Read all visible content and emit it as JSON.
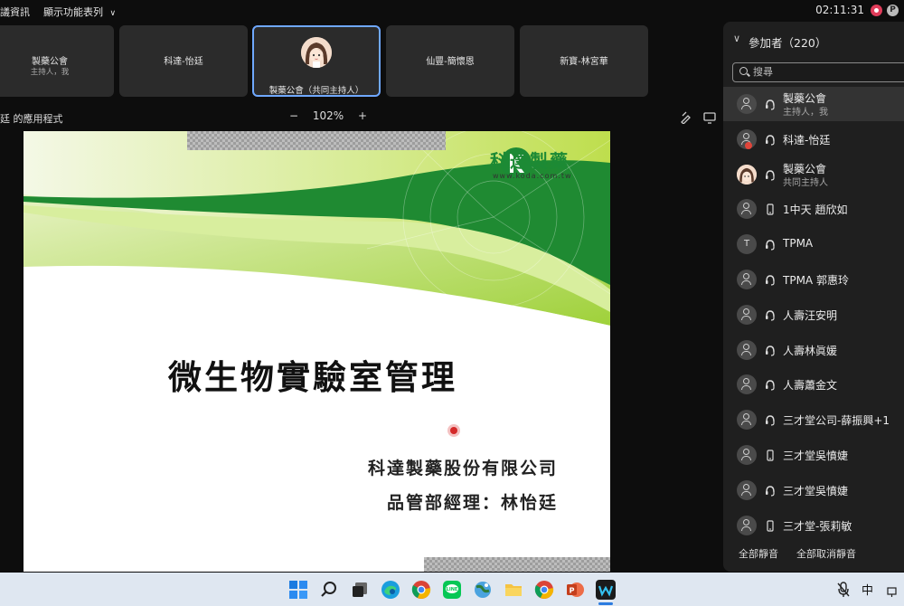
{
  "topbar": {
    "menu_info": "議資訊",
    "menu_toolbar": "顯示功能表列",
    "clock": "02:11:31"
  },
  "tiles": [
    {
      "name": "製藥公會",
      "sub": "主持人，我"
    },
    {
      "name": "科達-怡廷",
      "sub": ""
    },
    {
      "name": "製藥公會（共同主持人）",
      "sub": ""
    },
    {
      "name": "仙豐-簡懷恩",
      "sub": ""
    },
    {
      "name": "新寶-林宮華",
      "sub": ""
    }
  ],
  "share": {
    "app_label": "廷 的應用程式",
    "zoom": "102%"
  },
  "slide": {
    "logo_text": "科達製藥",
    "logo_url": "www.koda.com.tw",
    "title": "微生物實驗室管理",
    "company": "科達製藥股份有限公司",
    "manager": "品管部經理：林怡廷"
  },
  "panel": {
    "title": "參加者（220）",
    "search_placeholder": "搜尋",
    "participants": [
      {
        "name": "製藥公會",
        "sub": "主持人，我",
        "device": "headset",
        "avatar": "user"
      },
      {
        "name": "科達-怡廷",
        "sub": "",
        "device": "headset",
        "avatar": "user-badge"
      },
      {
        "name": "製藥公會",
        "sub": "共同主持人",
        "device": "headset",
        "avatar": "picture"
      },
      {
        "name": "1中天 趙欣如",
        "sub": "",
        "device": "phone",
        "avatar": "user"
      },
      {
        "name": "TPMA",
        "sub": "",
        "device": "headset",
        "avatar": "T"
      },
      {
        "name": "TPMA 郭惠玲",
        "sub": "",
        "device": "headset",
        "avatar": "user"
      },
      {
        "name": "人壽汪安明",
        "sub": "",
        "device": "headset",
        "avatar": "user"
      },
      {
        "name": "人壽林眞媛",
        "sub": "",
        "device": "headset",
        "avatar": "user"
      },
      {
        "name": "人壽蕭金文",
        "sub": "",
        "device": "headset",
        "avatar": "user"
      },
      {
        "name": "三才堂公司-薛振興+1",
        "sub": "",
        "device": "headset",
        "avatar": "user"
      },
      {
        "name": "三才堂吳憤婕",
        "sub": "",
        "device": "phone",
        "avatar": "user"
      },
      {
        "name": "三才堂吳憤婕",
        "sub": "",
        "device": "headset",
        "avatar": "user"
      },
      {
        "name": "三才堂-張莉敏",
        "sub": "",
        "device": "phone",
        "avatar": "user"
      }
    ],
    "mute_all": "全部靜音",
    "unmute_all": "全部取消靜音"
  },
  "taskbar": {
    "ime": "中",
    "apps": [
      "windows-start",
      "search",
      "task-view",
      "edge",
      "chrome",
      "line",
      "browser-globe",
      "file-explorer",
      "chrome-2",
      "powerpoint",
      "webex"
    ]
  },
  "colors": {
    "slide_green_dark": "#1f8a32",
    "slide_green_light": "#a9d93b",
    "active_tile_border": "#6fa8ff",
    "record_red": "#e03c5a"
  }
}
